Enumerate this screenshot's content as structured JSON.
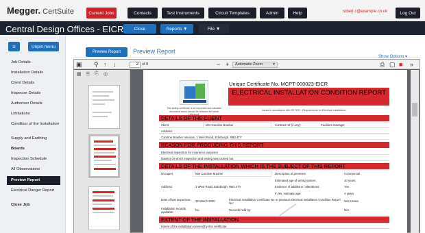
{
  "brand": {
    "name": "Megger.",
    "suite": "CertSuite",
    "user_email": "robert.c@example.co.uk"
  },
  "nav": {
    "current_jobs": "Current Jobs",
    "contacts": "Contacts",
    "test_instruments": "Test Instruments",
    "circuit_templates": "Circuit Templates",
    "admin": "Admin",
    "help": "Help",
    "logout": "Log Out"
  },
  "title_bar": {
    "title": "Central Design Offices - EICR",
    "close": "Close",
    "reports": "Reports ▼",
    "file": "File ▼"
  },
  "sidebar": {
    "unpin": "Unpin menu",
    "items": [
      "Job Details",
      "Installation Details",
      "Client Details",
      "Inspector Details",
      "Authoriser Details",
      "Limitations",
      "Condition of the Installation",
      "Supply and Earthing",
      "Boards",
      "Inspection Schedule",
      "All Observations",
      "Preview Report",
      "Electrical Danger Report",
      "Close Job"
    ]
  },
  "tabs": {
    "preview_button": "Preview Report",
    "preview_link": "Preview Report",
    "show_options": "Show Options ▾"
  },
  "viewer": {
    "page": "2",
    "of": "of 8",
    "zoom": "Automatic Zoom",
    "zoom_out": "−",
    "zoom_in": "+"
  },
  "cert": {
    "number": "Unique Certificate No.   MCPT-000023-EICR",
    "title": "ELECTRICAL INSTALLATION CONDITION REPORT",
    "logo_caption": "This safety certificate is an important and valuable document which should be retained for future reference",
    "issued": "Issued in accordance with BS 7671 - Requirements for Electrical Installations",
    "sections": {
      "client": "DETAILS OF THE CLIENT",
      "reason": "REASON FOR PRODUCING THIS REPORT",
      "installation": "DETAILS OF THE INSTALLATION WHICH IS THE SUBJECT OF THIS REPORT",
      "extent": "EXTENT OF THE INSTALLATION"
    },
    "client": {
      "client_label": "Client",
      "client_value": "Mrs Caroline Brasher",
      "contract_label": "Contract ref (if any):",
      "contract_value": "Facilities manager",
      "address_label": "Address:",
      "address_value": "Caroline Brasher Interiors, 1 West Road, Edinburgh, RB3 4TY"
    },
    "reason": {
      "line1": "Electrical inspection for insurance purposes",
      "line2": "Date(s) on which inspection and testing was carried out"
    },
    "install": {
      "occupier_label": "Occupier",
      "occupier_value": "Mrs Caroline Brasher",
      "desc_label": "Description of premises",
      "desc_value": "Commercial",
      "age_label": "Estimated age of wiring system:",
      "age_value": "10 years",
      "address_label": "Address:",
      "address_value": "1 West Road, Edinburgh, RB3 4TY",
      "alter_label": "Evidence of additions / alterations:",
      "alter_value": "Yes",
      "estimate_label": "If yes, estimate age:",
      "estimate_value": "4 years",
      "lastinsp_label": "Date of last inspection:",
      "lastinsp_value": "15 March 2020",
      "cert_label": "Electrical Installation Certificate No or previous Electrical Installation Condition Report No:",
      "cert_value": "Not Known",
      "records_label": "Installation records available:",
      "records_value": "No",
      "held_label": "Records held by:",
      "held_value": "N/A"
    },
    "extent": {
      "line1": "Extent of the installation covered by this certificate:"
    }
  },
  "colors": {
    "accent_red": "#d5282f",
    "brand_blue": "#1f6fba",
    "dark": "#1b1f2a"
  }
}
